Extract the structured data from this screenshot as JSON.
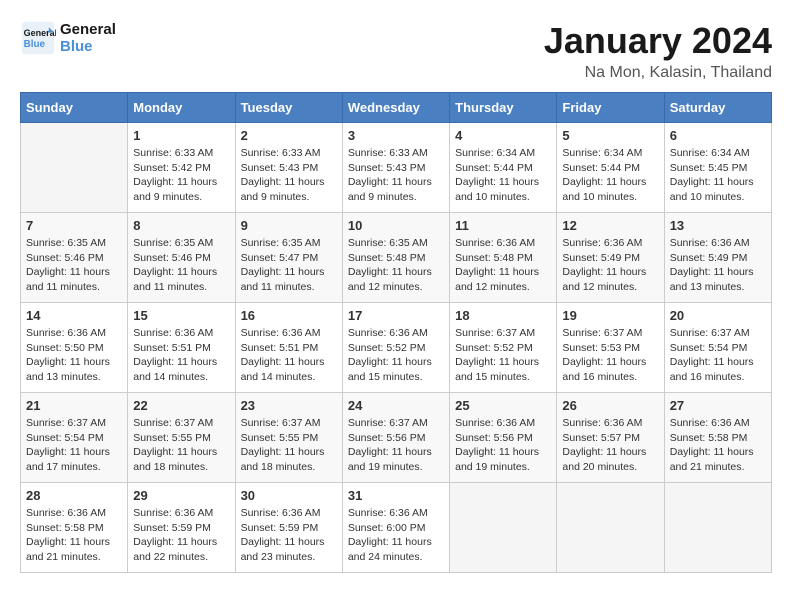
{
  "header": {
    "logo_line1": "General",
    "logo_line2": "Blue",
    "month": "January 2024",
    "location": "Na Mon, Kalasin, Thailand"
  },
  "weekdays": [
    "Sunday",
    "Monday",
    "Tuesday",
    "Wednesday",
    "Thursday",
    "Friday",
    "Saturday"
  ],
  "weeks": [
    [
      {
        "day": "",
        "details": ""
      },
      {
        "day": "1",
        "details": "Sunrise: 6:33 AM\nSunset: 5:42 PM\nDaylight: 11 hours\nand 9 minutes."
      },
      {
        "day": "2",
        "details": "Sunrise: 6:33 AM\nSunset: 5:43 PM\nDaylight: 11 hours\nand 9 minutes."
      },
      {
        "day": "3",
        "details": "Sunrise: 6:33 AM\nSunset: 5:43 PM\nDaylight: 11 hours\nand 9 minutes."
      },
      {
        "day": "4",
        "details": "Sunrise: 6:34 AM\nSunset: 5:44 PM\nDaylight: 11 hours\nand 10 minutes."
      },
      {
        "day": "5",
        "details": "Sunrise: 6:34 AM\nSunset: 5:44 PM\nDaylight: 11 hours\nand 10 minutes."
      },
      {
        "day": "6",
        "details": "Sunrise: 6:34 AM\nSunset: 5:45 PM\nDaylight: 11 hours\nand 10 minutes."
      }
    ],
    [
      {
        "day": "7",
        "details": "Sunrise: 6:35 AM\nSunset: 5:46 PM\nDaylight: 11 hours\nand 11 minutes."
      },
      {
        "day": "8",
        "details": "Sunrise: 6:35 AM\nSunset: 5:46 PM\nDaylight: 11 hours\nand 11 minutes."
      },
      {
        "day": "9",
        "details": "Sunrise: 6:35 AM\nSunset: 5:47 PM\nDaylight: 11 hours\nand 11 minutes."
      },
      {
        "day": "10",
        "details": "Sunrise: 6:35 AM\nSunset: 5:48 PM\nDaylight: 11 hours\nand 12 minutes."
      },
      {
        "day": "11",
        "details": "Sunrise: 6:36 AM\nSunset: 5:48 PM\nDaylight: 11 hours\nand 12 minutes."
      },
      {
        "day": "12",
        "details": "Sunrise: 6:36 AM\nSunset: 5:49 PM\nDaylight: 11 hours\nand 12 minutes."
      },
      {
        "day": "13",
        "details": "Sunrise: 6:36 AM\nSunset: 5:49 PM\nDaylight: 11 hours\nand 13 minutes."
      }
    ],
    [
      {
        "day": "14",
        "details": "Sunrise: 6:36 AM\nSunset: 5:50 PM\nDaylight: 11 hours\nand 13 minutes."
      },
      {
        "day": "15",
        "details": "Sunrise: 6:36 AM\nSunset: 5:51 PM\nDaylight: 11 hours\nand 14 minutes."
      },
      {
        "day": "16",
        "details": "Sunrise: 6:36 AM\nSunset: 5:51 PM\nDaylight: 11 hours\nand 14 minutes."
      },
      {
        "day": "17",
        "details": "Sunrise: 6:36 AM\nSunset: 5:52 PM\nDaylight: 11 hours\nand 15 minutes."
      },
      {
        "day": "18",
        "details": "Sunrise: 6:37 AM\nSunset: 5:52 PM\nDaylight: 11 hours\nand 15 minutes."
      },
      {
        "day": "19",
        "details": "Sunrise: 6:37 AM\nSunset: 5:53 PM\nDaylight: 11 hours\nand 16 minutes."
      },
      {
        "day": "20",
        "details": "Sunrise: 6:37 AM\nSunset: 5:54 PM\nDaylight: 11 hours\nand 16 minutes."
      }
    ],
    [
      {
        "day": "21",
        "details": "Sunrise: 6:37 AM\nSunset: 5:54 PM\nDaylight: 11 hours\nand 17 minutes."
      },
      {
        "day": "22",
        "details": "Sunrise: 6:37 AM\nSunset: 5:55 PM\nDaylight: 11 hours\nand 18 minutes."
      },
      {
        "day": "23",
        "details": "Sunrise: 6:37 AM\nSunset: 5:55 PM\nDaylight: 11 hours\nand 18 minutes."
      },
      {
        "day": "24",
        "details": "Sunrise: 6:37 AM\nSunset: 5:56 PM\nDaylight: 11 hours\nand 19 minutes."
      },
      {
        "day": "25",
        "details": "Sunrise: 6:36 AM\nSunset: 5:56 PM\nDaylight: 11 hours\nand 19 minutes."
      },
      {
        "day": "26",
        "details": "Sunrise: 6:36 AM\nSunset: 5:57 PM\nDaylight: 11 hours\nand 20 minutes."
      },
      {
        "day": "27",
        "details": "Sunrise: 6:36 AM\nSunset: 5:58 PM\nDaylight: 11 hours\nand 21 minutes."
      }
    ],
    [
      {
        "day": "28",
        "details": "Sunrise: 6:36 AM\nSunset: 5:58 PM\nDaylight: 11 hours\nand 21 minutes."
      },
      {
        "day": "29",
        "details": "Sunrise: 6:36 AM\nSunset: 5:59 PM\nDaylight: 11 hours\nand 22 minutes."
      },
      {
        "day": "30",
        "details": "Sunrise: 6:36 AM\nSunset: 5:59 PM\nDaylight: 11 hours\nand 23 minutes."
      },
      {
        "day": "31",
        "details": "Sunrise: 6:36 AM\nSunset: 6:00 PM\nDaylight: 11 hours\nand 24 minutes."
      },
      {
        "day": "",
        "details": ""
      },
      {
        "day": "",
        "details": ""
      },
      {
        "day": "",
        "details": ""
      }
    ]
  ]
}
